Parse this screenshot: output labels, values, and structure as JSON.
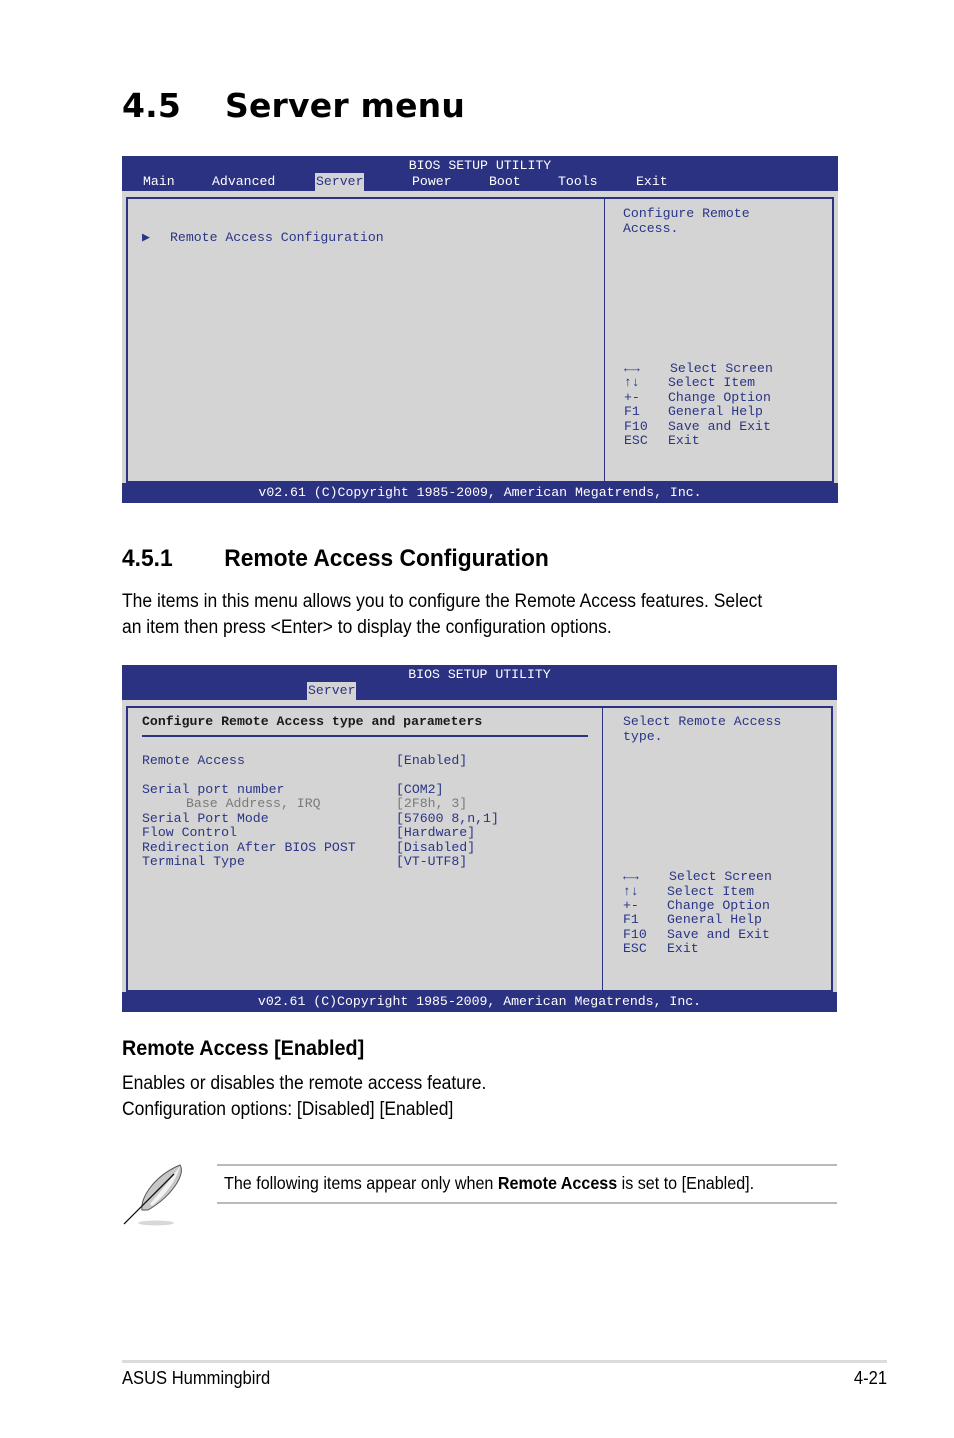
{
  "page": {
    "section_number": "4.5",
    "section_title": "Server menu",
    "subsection_number": "4.5.1",
    "subsection_title": "Remote Access Configuration",
    "intro_line1": "The items in this menu allows you to configure the Remote Access features. Select",
    "intro_line2": "an item then press <Enter> to display the configuration options.",
    "item_heading": "Remote Access [Enabled]",
    "item_desc_line1": "Enables or disables the remote access feature.",
    "item_desc_line2": "Configuration options: [Disabled] [Enabled]",
    "note": {
      "icon": "feather-pen-icon",
      "prefix": "The following items appear only when ",
      "bold": "Remote Access",
      "suffix": " is set to [Enabled]."
    },
    "footer_left": "ASUS Hummingbird",
    "footer_right": "4-21"
  },
  "colors": {
    "bios_blue": "#2b3282",
    "bios_gray": "#d4d4d4",
    "bios_text": "#2a3585"
  },
  "bios1": {
    "title": "BIOS SETUP UTILITY",
    "tabs": [
      "Main",
      "Advanced",
      "Server",
      "Power",
      "Boot",
      "Tools",
      "Exit"
    ],
    "active_tab": "Server",
    "submenu_label": "Remote Access Configuration",
    "submenu_icon": "triangle-right-icon",
    "help_line1": "Configure Remote",
    "help_line2": "Access.",
    "keys": [
      {
        "key": "←→",
        "desc": "Select Screen"
      },
      {
        "key": "↑↓",
        "desc": "Select Item"
      },
      {
        "key": "+-",
        "desc": "Change Option"
      },
      {
        "key": "F1",
        "desc": "General Help"
      },
      {
        "key": "F10",
        "desc": "Save and Exit"
      },
      {
        "key": "ESC",
        "desc": "Exit"
      }
    ],
    "copyright": "v02.61 (C)Copyright 1985-2009, American Megatrends, Inc."
  },
  "bios2": {
    "title": "BIOS SETUP UTILITY",
    "active_tab": "Server",
    "panel_heading": "Configure Remote Access type and parameters",
    "settings": [
      {
        "label": "Remote Access",
        "value": "[Enabled]"
      },
      {
        "label": "Serial port number",
        "value": "[COM2]"
      },
      {
        "label": "Base Address, IRQ",
        "value": "[2F8h, 3]"
      },
      {
        "label": "Serial Port Mode",
        "value": "[57600 8,n,1]"
      },
      {
        "label": "Flow Control",
        "value": "[Hardware]"
      },
      {
        "label": "Redirection After BIOS POST",
        "value": "[Disabled]"
      },
      {
        "label": "Terminal Type",
        "value": "[VT-UTF8]"
      }
    ],
    "help_line1": "Select Remote Access",
    "help_line2": "type.",
    "keys": [
      {
        "key": "←→",
        "desc": "Select Screen"
      },
      {
        "key": "↑↓",
        "desc": "Select Item"
      },
      {
        "key": "+-",
        "desc": "Change Option"
      },
      {
        "key": "F1",
        "desc": "General Help"
      },
      {
        "key": "F10",
        "desc": "Save and Exit"
      },
      {
        "key": "ESC",
        "desc": "Exit"
      }
    ],
    "copyright": "v02.61 (C)Copyright 1985-2009, American Megatrends, Inc."
  }
}
